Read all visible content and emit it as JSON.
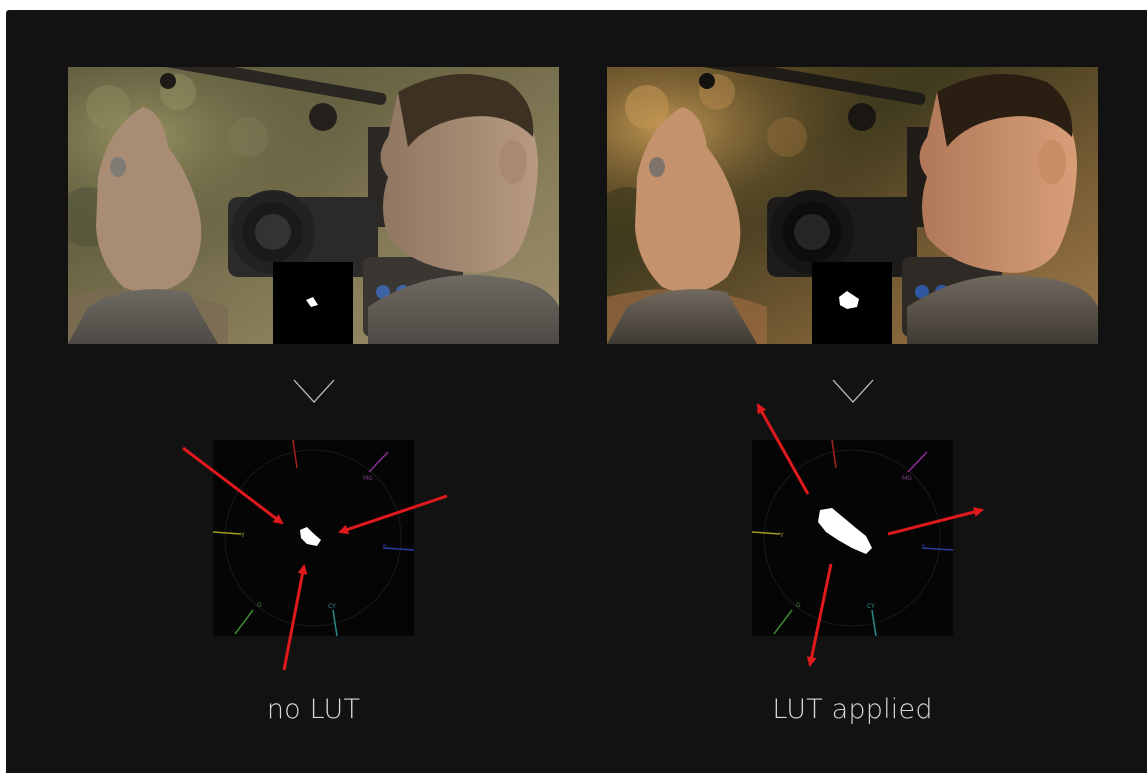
{
  "panels": [
    {
      "id": "no-lut",
      "caption": "no LUT",
      "scope_labels": [
        "R",
        "MG",
        "B",
        "CY",
        "G",
        "Y",
        "YL"
      ]
    },
    {
      "id": "lut-applied",
      "caption": "LUT applied",
      "scope_labels": [
        "R",
        "MG",
        "B",
        "CY",
        "G",
        "Y",
        "YL"
      ]
    }
  ],
  "colors": {
    "background": "#121212",
    "caption": "#d8d8d8",
    "arrow": "#e0191c"
  },
  "icons": {
    "divider": "chevron-down-icon"
  }
}
